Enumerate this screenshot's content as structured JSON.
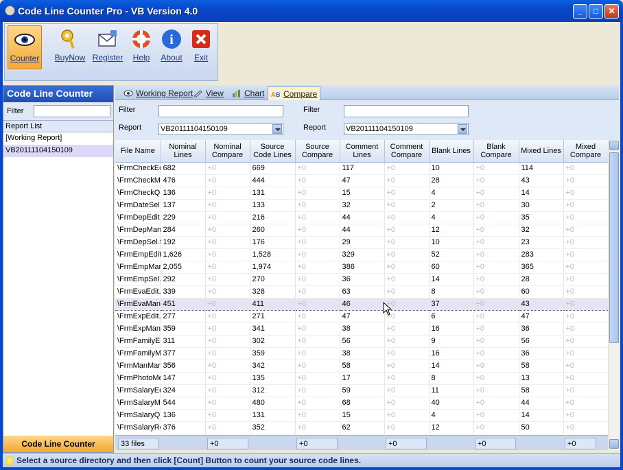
{
  "window": {
    "title": "Code Line Counter Pro - VB Version 4.0"
  },
  "toolbar": {
    "buttons": [
      {
        "label": "Counter",
        "icon": "eye-icon",
        "active": true
      },
      {
        "label": "BuyNow",
        "icon": "key-icon"
      },
      {
        "label": "Register",
        "icon": "envelope-icon"
      },
      {
        "label": "Help",
        "icon": "lifebuoy-icon"
      },
      {
        "label": "About",
        "icon": "info-icon"
      },
      {
        "label": "Exit",
        "icon": "exit-icon"
      }
    ]
  },
  "left_pane": {
    "title": "Code Line Counter",
    "filter_label": "Filter",
    "filter_value": "",
    "section_label": "Report List",
    "items": [
      "[Working Report]",
      "VB20111104150109"
    ],
    "footer": "Code Line Counter"
  },
  "tabs": [
    {
      "label": "Working Report",
      "icon": "eye-icon"
    },
    {
      "label": "View",
      "icon": "pencil-icon"
    },
    {
      "label": "Chart",
      "icon": "chart-icon"
    },
    {
      "label": "Compare",
      "icon": "compare-icon",
      "active": true
    }
  ],
  "compare": {
    "left": {
      "filter_label": "Filter",
      "filter_value": "",
      "report_label": "Report",
      "report_value": "VB20111104150109"
    },
    "right": {
      "filter_label": "Filter",
      "filter_value": "",
      "report_label": "Report",
      "report_value": "VB20111104150109"
    }
  },
  "grid": {
    "columns": [
      "File Name",
      "Nominal Lines",
      "Nominal Compare",
      "Source Code Lines",
      "Source Compare",
      "Comment Lines",
      "Comment Compare",
      "Blank Lines",
      "Blank Compare",
      "Mixed Lines",
      "Mixed Compare"
    ],
    "selected_row": 11,
    "rows": [
      [
        "\\FrmCheckEc",
        "682",
        "+0",
        "669",
        "+0",
        "117",
        "+0",
        "10",
        "+0",
        "114",
        "+0"
      ],
      [
        "\\FrmCheckM",
        "476",
        "+0",
        "444",
        "+0",
        "47",
        "+0",
        "28",
        "+0",
        "43",
        "+0"
      ],
      [
        "\\FrmCheckQ",
        "136",
        "+0",
        "131",
        "+0",
        "15",
        "+0",
        "4",
        "+0",
        "14",
        "+0"
      ],
      [
        "\\FrmDateSel",
        "137",
        "+0",
        "133",
        "+0",
        "32",
        "+0",
        "2",
        "+0",
        "30",
        "+0"
      ],
      [
        "\\FrmDepEdit",
        "229",
        "+0",
        "216",
        "+0",
        "44",
        "+0",
        "4",
        "+0",
        "35",
        "+0"
      ],
      [
        "\\FrmDepMan",
        "284",
        "+0",
        "260",
        "+0",
        "44",
        "+0",
        "12",
        "+0",
        "32",
        "+0"
      ],
      [
        "\\FrmDepSel.f",
        "192",
        "+0",
        "176",
        "+0",
        "29",
        "+0",
        "10",
        "+0",
        "23",
        "+0"
      ],
      [
        "\\FrmEmpEdit",
        "1,626",
        "+0",
        "1,528",
        "+0",
        "329",
        "+0",
        "52",
        "+0",
        "283",
        "+0"
      ],
      [
        "\\FrmEmpMar",
        "2,055",
        "+0",
        "1,974",
        "+0",
        "386",
        "+0",
        "60",
        "+0",
        "365",
        "+0"
      ],
      [
        "\\FrmEmpSel.",
        "292",
        "+0",
        "270",
        "+0",
        "36",
        "+0",
        "14",
        "+0",
        "28",
        "+0"
      ],
      [
        "\\FrmEvaEdit.",
        "339",
        "+0",
        "328",
        "+0",
        "63",
        "+0",
        "8",
        "+0",
        "60",
        "+0"
      ],
      [
        "\\FrmEvaMan",
        "451",
        "+0",
        "411",
        "+0",
        "46",
        "+0",
        "37",
        "+0",
        "43",
        "+0"
      ],
      [
        "\\FrmExpEdit.",
        "277",
        "+0",
        "271",
        "+0",
        "47",
        "+0",
        "6",
        "+0",
        "47",
        "+0"
      ],
      [
        "\\FrmExpMan",
        "359",
        "+0",
        "341",
        "+0",
        "38",
        "+0",
        "16",
        "+0",
        "36",
        "+0"
      ],
      [
        "\\FrmFamilyEc",
        "311",
        "+0",
        "302",
        "+0",
        "56",
        "+0",
        "9",
        "+0",
        "56",
        "+0"
      ],
      [
        "\\FrmFamilyM",
        "377",
        "+0",
        "359",
        "+0",
        "38",
        "+0",
        "16",
        "+0",
        "36",
        "+0"
      ],
      [
        "\\FrmManMar",
        "356",
        "+0",
        "342",
        "+0",
        "58",
        "+0",
        "14",
        "+0",
        "58",
        "+0"
      ],
      [
        "\\FrmPhotoMe",
        "147",
        "+0",
        "135",
        "+0",
        "17",
        "+0",
        "8",
        "+0",
        "13",
        "+0"
      ],
      [
        "\\FrmSalaryEc",
        "324",
        "+0",
        "312",
        "+0",
        "59",
        "+0",
        "11",
        "+0",
        "58",
        "+0"
      ],
      [
        "\\FrmSalaryM",
        "544",
        "+0",
        "480",
        "+0",
        "68",
        "+0",
        "40",
        "+0",
        "44",
        "+0"
      ],
      [
        "\\FrmSalaryQ",
        "136",
        "+0",
        "131",
        "+0",
        "15",
        "+0",
        "4",
        "+0",
        "14",
        "+0"
      ],
      [
        "\\FrmSalaryRe",
        "376",
        "+0",
        "352",
        "+0",
        "62",
        "+0",
        "12",
        "+0",
        "50",
        "+0"
      ]
    ]
  },
  "totals": [
    "33 files",
    "+0",
    "+0",
    "+0",
    "+0",
    "+0"
  ],
  "status": {
    "text": "Select a source directory and then click [Count] Button to count your source code lines."
  },
  "colors": {
    "title_blue": "#0A48C9",
    "accent_orange": "#F8A936",
    "compare_gray": "#bbbbbb"
  }
}
